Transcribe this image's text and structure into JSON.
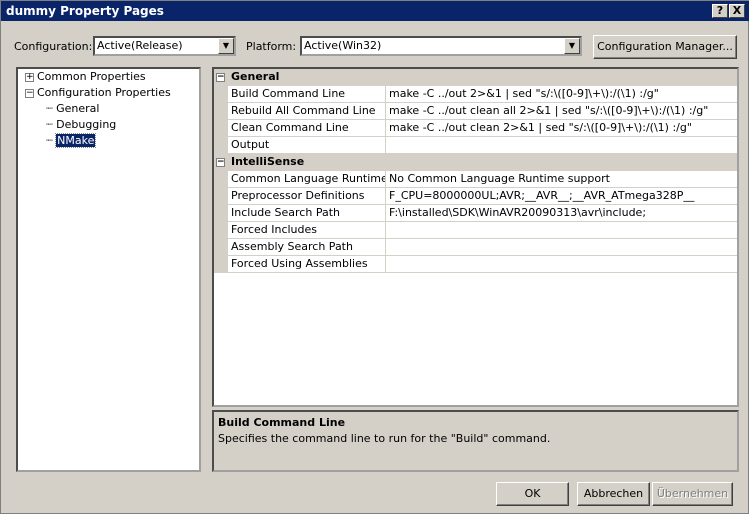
{
  "window": {
    "title": "dummy Property Pages",
    "help": "?",
    "close": "X"
  },
  "toolbar": {
    "configuration_label": "Configuration:",
    "configuration_value": "Active(Release)",
    "platform_label": "Platform:",
    "platform_value": "Active(Win32)",
    "config_manager": "Configuration Manager..."
  },
  "tree": {
    "common": "Common Properties",
    "config": "Configuration Properties",
    "children": [
      "General",
      "Debugging",
      "NMake"
    ]
  },
  "grid": {
    "categories": [
      {
        "name": "General",
        "rows": [
          {
            "name": "Build Command Line",
            "value": "make -C ../out 2>&1 | sed \"s/:\\([0-9]\\+\\):/(\\1) :/g\""
          },
          {
            "name": "Rebuild All Command Line",
            "value": "make -C ../out clean all 2>&1 | sed \"s/:\\([0-9]\\+\\):/(\\1) :/g\""
          },
          {
            "name": "Clean Command Line",
            "value": "make -C ../out clean 2>&1 | sed \"s/:\\([0-9]\\+\\):/(\\1) :/g\""
          },
          {
            "name": "Output",
            "value": ""
          }
        ]
      },
      {
        "name": "IntelliSense",
        "rows": [
          {
            "name": "Common Language Runtime Support",
            "value": "No Common Language Runtime support"
          },
          {
            "name": "Preprocessor Definitions",
            "value": "F_CPU=8000000UL;AVR;__AVR__;__AVR_ATmega328P__"
          },
          {
            "name": "Include Search Path",
            "value": "F:\\installed\\SDK\\WinAVR20090313\\avr\\include;"
          },
          {
            "name": "Forced Includes",
            "value": ""
          },
          {
            "name": "Assembly Search Path",
            "value": ""
          },
          {
            "name": "Forced Using Assemblies",
            "value": ""
          }
        ]
      }
    ]
  },
  "description": {
    "title": "Build Command Line",
    "text": "Specifies the command line to run for the \"Build\" command."
  },
  "buttons": {
    "ok": "OK",
    "cancel": "Abbrechen",
    "apply": "Übernehmen"
  }
}
